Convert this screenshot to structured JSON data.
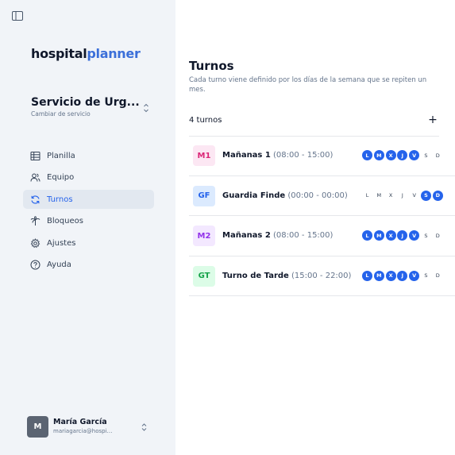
{
  "sidebar": {
    "logo": {
      "part1": "hospital",
      "part2": "planner"
    },
    "service": {
      "name": "Servicio de Urg...",
      "sub": "Cambiar de servicio"
    },
    "nav": [
      {
        "label": "Planilla",
        "icon": "table-icon",
        "active": false
      },
      {
        "label": "Equipo",
        "icon": "users-icon",
        "active": false
      },
      {
        "label": "Turnos",
        "icon": "refresh-icon",
        "active": true
      },
      {
        "label": "Bloqueos",
        "icon": "palm-tree-icon",
        "active": false
      },
      {
        "label": "Ajustes",
        "icon": "gear-icon",
        "active": false
      },
      {
        "label": "Ayuda",
        "icon": "help-circle-icon",
        "active": false
      }
    ],
    "user": {
      "initial": "M",
      "name": "María García",
      "email": "mariagarcia@hospitalpl..."
    }
  },
  "main": {
    "title": "Turnos",
    "subtitle": "Cada turno viene definido por los días de la semana que se repiten un mes.",
    "count": "4 turnos",
    "add_label": "+",
    "shifts": [
      {
        "code": "M1",
        "name": "Mañanas 1",
        "time": "(08:00 - 15:00)",
        "badge_bg": "#fce7f3",
        "badge_fg": "#db2777",
        "days": [
          [
            "L",
            true
          ],
          [
            "M",
            true
          ],
          [
            "X",
            true
          ],
          [
            "J",
            true
          ],
          [
            "V",
            true
          ],
          [
            "S",
            false
          ],
          [
            "D",
            false
          ]
        ]
      },
      {
        "code": "GF",
        "name": "Guardia Finde",
        "time": "(00:00 - 00:00)",
        "badge_bg": "#dbeafe",
        "badge_fg": "#2563eb",
        "days": [
          [
            "L",
            false
          ],
          [
            "M",
            false
          ],
          [
            "X",
            false
          ],
          [
            "J",
            false
          ],
          [
            "V",
            false
          ],
          [
            "S",
            true
          ],
          [
            "D",
            true
          ]
        ]
      },
      {
        "code": "M2",
        "name": "Mañanas 2",
        "time": "(08:00 - 15:00)",
        "badge_bg": "#f3e8ff",
        "badge_fg": "#9333ea",
        "days": [
          [
            "L",
            true
          ],
          [
            "M",
            true
          ],
          [
            "X",
            true
          ],
          [
            "J",
            true
          ],
          [
            "V",
            true
          ],
          [
            "S",
            false
          ],
          [
            "D",
            false
          ]
        ]
      },
      {
        "code": "GT",
        "name": "Turno de Tarde",
        "time": "(15:00 - 22:00)",
        "badge_bg": "#dcfce7",
        "badge_fg": "#16a34a",
        "days": [
          [
            "L",
            true
          ],
          [
            "M",
            true
          ],
          [
            "X",
            true
          ],
          [
            "J",
            true
          ],
          [
            "V",
            true
          ],
          [
            "S",
            false
          ],
          [
            "D",
            false
          ]
        ]
      }
    ]
  },
  "colors": {
    "accent": "#2563eb",
    "sidebar_bg": "#f1f4f8",
    "brand_dark": "#0f172a",
    "brand_blue": "#3b6fd9"
  }
}
